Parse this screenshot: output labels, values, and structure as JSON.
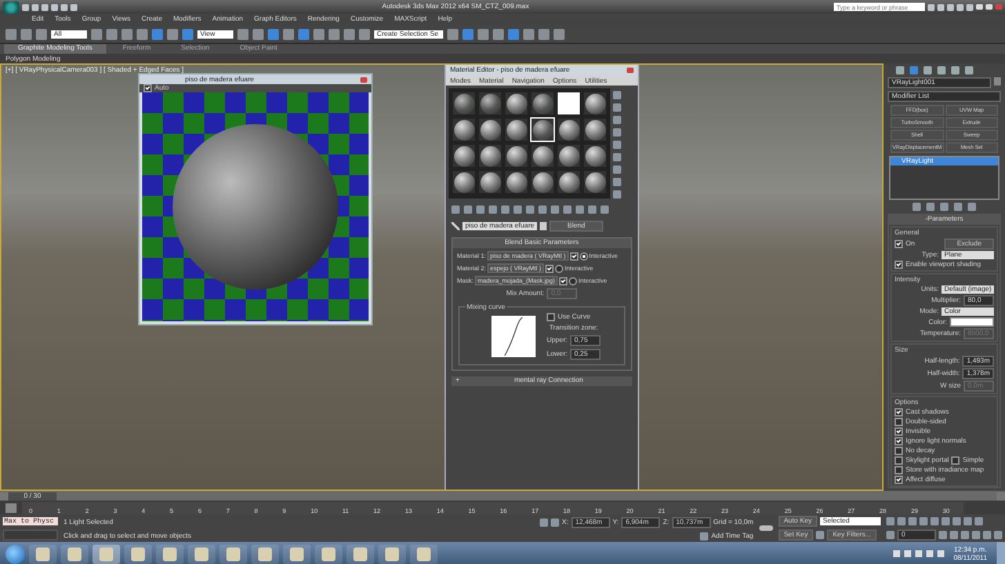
{
  "window": {
    "title": "Autodesk 3ds Max 2012 x64     SM_CTZ_009.max"
  },
  "search": {
    "placeholder": "Type a keyword or phrase"
  },
  "menu": [
    "Edit",
    "Tools",
    "Group",
    "Views",
    "Create",
    "Modifiers",
    "Animation",
    "Graph Editors",
    "Rendering",
    "Customize",
    "MAXScript",
    "Help"
  ],
  "toolbar": {
    "selection_filter": "All",
    "reference_coordinate": "View",
    "named_selection": "Create Selection Se",
    "tools": [
      {
        "selected": false
      },
      {
        "selected": false
      },
      {
        "selected": false
      },
      {
        "selected": false
      },
      {
        "selected": false
      },
      {
        "selected": false
      },
      {
        "selected": false
      },
      {
        "selected": true
      },
      {
        "selected": false
      },
      {
        "selected": true
      },
      {
        "selected": false
      },
      {
        "selected": false
      },
      {
        "selected": true
      },
      {
        "selected": false
      },
      {
        "selected": true
      },
      {
        "selected": false
      },
      {
        "selected": false
      },
      {
        "selected": false
      },
      {
        "selected": false
      },
      {
        "selected": false
      },
      {
        "selected": true
      },
      {
        "selected": false
      },
      {
        "selected": false
      },
      {
        "selected": true
      },
      {
        "selected": false
      },
      {
        "selected": false
      },
      {
        "selected": false
      }
    ]
  },
  "ribbon_tabs": [
    {
      "label": "Graphite Modeling Tools",
      "selected": true
    },
    {
      "label": "Freeform",
      "selected": false
    },
    {
      "label": "Selection",
      "selected": false
    },
    {
      "label": "Object Paint",
      "selected": false
    }
  ],
  "ribbon_panel": "Polygon Modeling",
  "viewport": {
    "label": "[+] [ VRayPhysicalCamera003 ] [ Shaded + Edged Faces ]"
  },
  "preview_window": {
    "title": "piso de madera efuare",
    "auto": {
      "label": "Auto",
      "checked": true
    }
  },
  "material_editor": {
    "title": "Material Editor - piso de madera efuare",
    "menus": [
      "Modes",
      "Material",
      "Navigation",
      "Options",
      "Utilities"
    ],
    "slots": [
      {
        "kind": "textured",
        "selected": false
      },
      {
        "kind": "textured",
        "selected": false
      },
      {
        "kind": "plain",
        "selected": false
      },
      {
        "kind": "textured",
        "selected": false
      },
      {
        "kind": "white",
        "selected": false
      },
      {
        "kind": "plain",
        "selected": false
      },
      {
        "kind": "plain",
        "selected": false
      },
      {
        "kind": "plain",
        "selected": false
      },
      {
        "kind": "plain",
        "selected": false
      },
      {
        "kind": "textured",
        "selected": true
      },
      {
        "kind": "plain",
        "selected": false
      },
      {
        "kind": "plain",
        "selected": false
      },
      {
        "kind": "plain",
        "selected": false
      },
      {
        "kind": "plain",
        "selected": false
      },
      {
        "kind": "plain",
        "selected": false
      },
      {
        "kind": "plain",
        "selected": false
      },
      {
        "kind": "plain",
        "selected": false
      },
      {
        "kind": "plain",
        "selected": false
      },
      {
        "kind": "plain",
        "selected": false
      },
      {
        "kind": "plain",
        "selected": false
      },
      {
        "kind": "plain",
        "selected": false
      },
      {
        "kind": "plain",
        "selected": false
      },
      {
        "kind": "plain",
        "selected": false
      },
      {
        "kind": "plain",
        "selected": false
      }
    ],
    "material_name": "piso de madera efuare",
    "material_type": "Blend",
    "rollout": "Blend Basic Parameters",
    "maps": [
      {
        "label": "Material 1:",
        "value": "piso de madera  ( VRayMtl )",
        "checked": true,
        "interactive": true,
        "interactive_label": "Interactive"
      },
      {
        "label": "Material 2:",
        "value": "espejo  ( VRayMtl )",
        "checked": true,
        "interactive": false,
        "interactive_label": "Interactive"
      },
      {
        "label": "Mask:",
        "value": "madera_mojada_(Mask.jpg)",
        "checked": true,
        "interactive": false,
        "interactive_label": "Interactive"
      }
    ],
    "mix_amount": {
      "label": "Mix Amount:",
      "value": "0,0",
      "disabled": true
    },
    "mixing_curve": {
      "title": "Mixing curve",
      "use_curve": {
        "label": "Use Curve",
        "checked": false
      },
      "transition_label": "Transition zone:",
      "upper": {
        "label": "Upper:",
        "value": "0,75"
      },
      "lower": {
        "label": "Lower:",
        "value": "0,25"
      }
    },
    "collapsed_rollout": {
      "sign": "+",
      "title": "mental ray Connection"
    }
  },
  "command_panel": {
    "object_name": "VRayLight001",
    "modifier_list": "Modifier List",
    "modifiers": [
      "FFD(box)",
      "UVW Map",
      "TurboSmooth",
      "Extrude",
      "Shell",
      "Sweep",
      "VRayDisplacementM",
      "Mesh Sel"
    ],
    "stack": [
      {
        "label": "VRayLight",
        "selected": true
      }
    ],
    "rollout": {
      "sign": "-",
      "title": "Parameters"
    },
    "groups": [
      {
        "title": "General",
        "rows": [
          {
            "kind": "check_button",
            "label": "On",
            "checked": true,
            "button": "Exclude"
          },
          {
            "kind": "dropdown",
            "label": "Type:",
            "value": "Plane"
          },
          {
            "kind": "check",
            "label": "Enable viewport shading",
            "checked": true
          }
        ]
      },
      {
        "title": "Intensity",
        "rows": [
          {
            "kind": "dropdown",
            "label": "Units:",
            "value": "Default (image)"
          },
          {
            "kind": "spinner",
            "label": "Multiplier:",
            "value": "80,0",
            "disabled": false
          },
          {
            "kind": "dropdown",
            "label": "Mode:",
            "value": "Color"
          },
          {
            "kind": "swatch",
            "label": "Color:",
            "color": "#ffffff"
          },
          {
            "kind": "spinner",
            "label": "Temperature:",
            "value": "6500,0",
            "disabled": true
          }
        ]
      },
      {
        "title": "Size",
        "rows": [
          {
            "kind": "spinner",
            "label": "Half-length:",
            "value": "1,493m",
            "disabled": false
          },
          {
            "kind": "spinner",
            "label": "Half-width:",
            "value": "1,378m",
            "disabled": false
          },
          {
            "kind": "spinner",
            "label": "W size",
            "value": "0,0m",
            "disabled": true
          }
        ]
      },
      {
        "title": "Options",
        "rows": [
          {
            "kind": "check",
            "label": "Cast shadows",
            "checked": true
          },
          {
            "kind": "check",
            "label": "Double-sided",
            "checked": false
          },
          {
            "kind": "check",
            "label": "Invisible",
            "checked": true
          },
          {
            "kind": "check",
            "label": "Ignore light normals",
            "checked": true
          },
          {
            "kind": "check",
            "label": "No decay",
            "checked": false
          },
          {
            "kind": "check_pair",
            "label": "Skylight portal",
            "checked": false,
            "label2": "Simple",
            "checked2": false
          },
          {
            "kind": "check",
            "label": "Store with irradiance map",
            "checked": false
          },
          {
            "kind": "check",
            "label": "Affect diffuse",
            "checked": true
          }
        ]
      }
    ]
  },
  "timeline": {
    "slider": "0 / 30",
    "level": 0,
    "ticks": [
      "0",
      "1",
      "2",
      "3",
      "4",
      "5",
      "6",
      "7",
      "8",
      "9",
      "10",
      "11",
      "12",
      "13",
      "14",
      "15",
      "16",
      "17",
      "18",
      "19",
      "20",
      "21",
      "22",
      "23",
      "24",
      "25",
      "26",
      "27",
      "28",
      "29",
      "30"
    ]
  },
  "status": {
    "listener": "Max to Physc",
    "selection": "1 Light Selected",
    "prompt": "Click and drag to select and move objects",
    "coords": [
      {
        "label": "X:",
        "value": "12,468m"
      },
      {
        "label": "Y:",
        "value": "6,904m"
      },
      {
        "label": "Z:",
        "value": "10,737m"
      }
    ],
    "grid": "Grid = 10,0m",
    "time_tag": "Add Time Tag",
    "auto_key": "Auto Key",
    "key_mode": "Selected",
    "set_key": "Set Key",
    "key_filters": "Key Filters...",
    "frame": "0"
  },
  "taskbar": {
    "apps": [
      {
        "selected": false
      },
      {
        "selected": false
      },
      {
        "selected": true
      },
      {
        "selected": false
      },
      {
        "selected": false
      },
      {
        "selected": false
      },
      {
        "selected": false
      },
      {
        "selected": false
      },
      {
        "selected": false
      },
      {
        "selected": false
      },
      {
        "selected": false
      },
      {
        "selected": false
      },
      {
        "selected": false
      }
    ],
    "time": "12:34 p.m.",
    "date": "08/11/2011"
  }
}
